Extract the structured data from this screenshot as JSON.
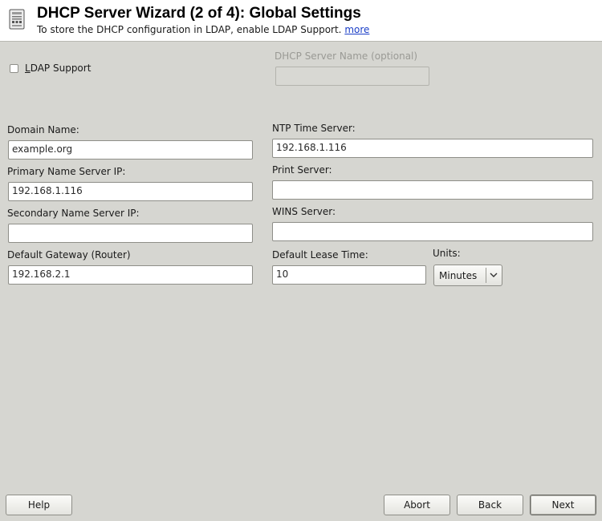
{
  "header": {
    "icon": "server-icon",
    "title": "DHCP Server Wizard (2 of 4): Global Settings",
    "subtitle": "To store the DHCP configuration in LDAP, enable LDAP Support.",
    "more_link": "more"
  },
  "ldap_support": {
    "label": "LDAP Support",
    "checked": false
  },
  "dhcp_server_name": {
    "label": "DHCP Server Name (optional)",
    "value": "",
    "enabled": false
  },
  "domain_name": {
    "label": "Domain Name:",
    "value": "example.org"
  },
  "primary_ns": {
    "label": "Primary Name Server IP:",
    "value": "192.168.1.116"
  },
  "secondary_ns": {
    "label": "Secondary Name Server IP:",
    "value": ""
  },
  "default_gateway": {
    "label": "Default Gateway (Router)",
    "value": "192.168.2.1"
  },
  "ntp_server": {
    "label": "NTP Time Server:",
    "value": "192.168.1.116"
  },
  "print_server": {
    "label": "Print Server:",
    "value": ""
  },
  "wins_server": {
    "label": "WINS Server:",
    "value": ""
  },
  "lease_time": {
    "label": "Default Lease Time:",
    "value": "10"
  },
  "units": {
    "label": "Units:",
    "selected": "Minutes"
  },
  "buttons": {
    "help": "Help",
    "abort": "Abort",
    "back": "Back",
    "next": "Next"
  }
}
